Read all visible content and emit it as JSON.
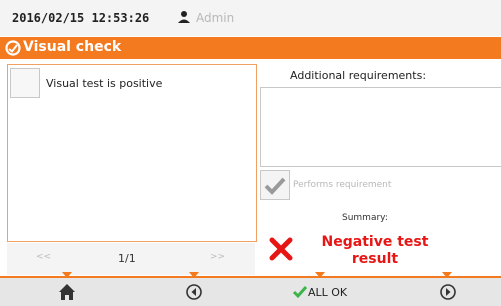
{
  "header": {
    "datetime": "2016/02/15 12:53:26",
    "username": "Admin"
  },
  "title": "Visual check",
  "left_panel": {
    "checkbox_label": "Visual test is positive",
    "checked": false
  },
  "pager": {
    "prev": "<<",
    "page": "1/1",
    "next": ">>"
  },
  "right_panel": {
    "requirements_label": "Additional requirements:",
    "requirements_value": "",
    "performs_label": "Performs requirement",
    "summary_label": "Summary:",
    "result_line1": "Negative test",
    "result_line2": "result"
  },
  "footer": {
    "all_ok_label": "ALL OK"
  },
  "colors": {
    "accent": "#f47a1f",
    "negative": "#e81515",
    "ok": "#3bb54a"
  },
  "icons": [
    "user-icon",
    "visual-check-icon",
    "checkmark-icon",
    "cross-icon",
    "home-icon",
    "back-arrow-icon",
    "ok-check-icon",
    "forward-arrow-icon"
  ]
}
